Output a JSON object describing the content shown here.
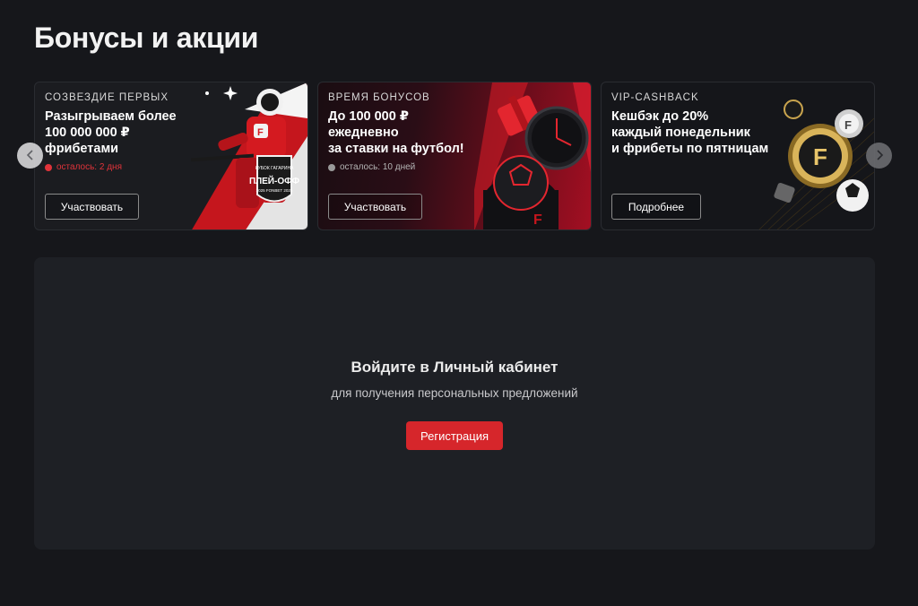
{
  "page": {
    "title": "Бонусы и акции"
  },
  "promos": [
    {
      "tag": "СОЗВЕЗДИЕ ПЕРВЫХ",
      "lines": [
        "Разыгрываем более",
        "100 000 000 ₽",
        "фрибетами"
      ],
      "timer": "осталось: 2 дня",
      "button": "Участвовать",
      "art": "hockey-player-playoff",
      "art_text": [
        "КУБОК ГАГАРИНА",
        "ПЛЕЙ-ОФФ",
        "2025 FONBET 2026"
      ],
      "accent": "#e0333a"
    },
    {
      "tag": "ВРЕМЯ БОНУСОВ",
      "lines": [
        "До 100 000 ₽",
        "ежедневно",
        "за ставки на футбол!"
      ],
      "timer": "осталось: 10 дней",
      "button": "Участвовать",
      "art": "gift-box-football-clock",
      "accent": "#b5b5b5"
    },
    {
      "tag": "VIP-CASHBACK",
      "lines": [
        "Кешбэк до 20%",
        "каждый понедельник",
        "и фрибеты по пятницам"
      ],
      "button": "Подробнее",
      "art": "gold-coins-f-logo",
      "accent": "#d4a94a"
    }
  ],
  "carousel": {
    "prev_icon": "chevron-left-icon",
    "next_icon": "chevron-right-icon"
  },
  "login": {
    "title": "Войдите в Личный кабинет",
    "subtitle": "для получения персональных предложений",
    "button": "Регистрация"
  },
  "colors": {
    "background": "#16171b",
    "panel": "#1e2025",
    "brand_red": "#d6262b"
  }
}
